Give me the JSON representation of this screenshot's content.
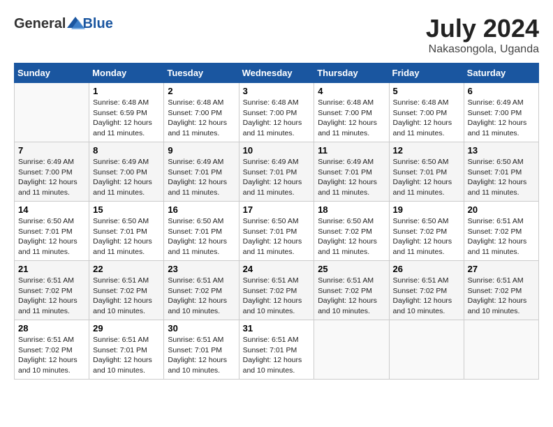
{
  "header": {
    "logo": {
      "general": "General",
      "blue": "Blue"
    },
    "title": "July 2024",
    "location": "Nakasongola, Uganda"
  },
  "weekdays": [
    "Sunday",
    "Monday",
    "Tuesday",
    "Wednesday",
    "Thursday",
    "Friday",
    "Saturday"
  ],
  "weeks": [
    [
      {
        "day": "",
        "info": ""
      },
      {
        "day": "1",
        "sunrise": "6:48 AM",
        "sunset": "6:59 PM",
        "daylight": "12 hours and 11 minutes."
      },
      {
        "day": "2",
        "sunrise": "6:48 AM",
        "sunset": "7:00 PM",
        "daylight": "12 hours and 11 minutes."
      },
      {
        "day": "3",
        "sunrise": "6:48 AM",
        "sunset": "7:00 PM",
        "daylight": "12 hours and 11 minutes."
      },
      {
        "day": "4",
        "sunrise": "6:48 AM",
        "sunset": "7:00 PM",
        "daylight": "12 hours and 11 minutes."
      },
      {
        "day": "5",
        "sunrise": "6:48 AM",
        "sunset": "7:00 PM",
        "daylight": "12 hours and 11 minutes."
      },
      {
        "day": "6",
        "sunrise": "6:49 AM",
        "sunset": "7:00 PM",
        "daylight": "12 hours and 11 minutes."
      }
    ],
    [
      {
        "day": "7",
        "sunrise": "6:49 AM",
        "sunset": "7:00 PM",
        "daylight": "12 hours and 11 minutes."
      },
      {
        "day": "8",
        "sunrise": "6:49 AM",
        "sunset": "7:00 PM",
        "daylight": "12 hours and 11 minutes."
      },
      {
        "day": "9",
        "sunrise": "6:49 AM",
        "sunset": "7:01 PM",
        "daylight": "12 hours and 11 minutes."
      },
      {
        "day": "10",
        "sunrise": "6:49 AM",
        "sunset": "7:01 PM",
        "daylight": "12 hours and 11 minutes."
      },
      {
        "day": "11",
        "sunrise": "6:49 AM",
        "sunset": "7:01 PM",
        "daylight": "12 hours and 11 minutes."
      },
      {
        "day": "12",
        "sunrise": "6:50 AM",
        "sunset": "7:01 PM",
        "daylight": "12 hours and 11 minutes."
      },
      {
        "day": "13",
        "sunrise": "6:50 AM",
        "sunset": "7:01 PM",
        "daylight": "12 hours and 11 minutes."
      }
    ],
    [
      {
        "day": "14",
        "sunrise": "6:50 AM",
        "sunset": "7:01 PM",
        "daylight": "12 hours and 11 minutes."
      },
      {
        "day": "15",
        "sunrise": "6:50 AM",
        "sunset": "7:01 PM",
        "daylight": "12 hours and 11 minutes."
      },
      {
        "day": "16",
        "sunrise": "6:50 AM",
        "sunset": "7:01 PM",
        "daylight": "12 hours and 11 minutes."
      },
      {
        "day": "17",
        "sunrise": "6:50 AM",
        "sunset": "7:01 PM",
        "daylight": "12 hours and 11 minutes."
      },
      {
        "day": "18",
        "sunrise": "6:50 AM",
        "sunset": "7:02 PM",
        "daylight": "12 hours and 11 minutes."
      },
      {
        "day": "19",
        "sunrise": "6:50 AM",
        "sunset": "7:02 PM",
        "daylight": "12 hours and 11 minutes."
      },
      {
        "day": "20",
        "sunrise": "6:51 AM",
        "sunset": "7:02 PM",
        "daylight": "12 hours and 11 minutes."
      }
    ],
    [
      {
        "day": "21",
        "sunrise": "6:51 AM",
        "sunset": "7:02 PM",
        "daylight": "12 hours and 11 minutes."
      },
      {
        "day": "22",
        "sunrise": "6:51 AM",
        "sunset": "7:02 PM",
        "daylight": "12 hours and 10 minutes."
      },
      {
        "day": "23",
        "sunrise": "6:51 AM",
        "sunset": "7:02 PM",
        "daylight": "12 hours and 10 minutes."
      },
      {
        "day": "24",
        "sunrise": "6:51 AM",
        "sunset": "7:02 PM",
        "daylight": "12 hours and 10 minutes."
      },
      {
        "day": "25",
        "sunrise": "6:51 AM",
        "sunset": "7:02 PM",
        "daylight": "12 hours and 10 minutes."
      },
      {
        "day": "26",
        "sunrise": "6:51 AM",
        "sunset": "7:02 PM",
        "daylight": "12 hours and 10 minutes."
      },
      {
        "day": "27",
        "sunrise": "6:51 AM",
        "sunset": "7:02 PM",
        "daylight": "12 hours and 10 minutes."
      }
    ],
    [
      {
        "day": "28",
        "sunrise": "6:51 AM",
        "sunset": "7:02 PM",
        "daylight": "12 hours and 10 minutes."
      },
      {
        "day": "29",
        "sunrise": "6:51 AM",
        "sunset": "7:01 PM",
        "daylight": "12 hours and 10 minutes."
      },
      {
        "day": "30",
        "sunrise": "6:51 AM",
        "sunset": "7:01 PM",
        "daylight": "12 hours and 10 minutes."
      },
      {
        "day": "31",
        "sunrise": "6:51 AM",
        "sunset": "7:01 PM",
        "daylight": "12 hours and 10 minutes."
      },
      {
        "day": "",
        "info": ""
      },
      {
        "day": "",
        "info": ""
      },
      {
        "day": "",
        "info": ""
      }
    ]
  ],
  "labels": {
    "sunrise_prefix": "Sunrise: ",
    "sunset_prefix": "Sunset: ",
    "daylight_prefix": "Daylight: "
  }
}
